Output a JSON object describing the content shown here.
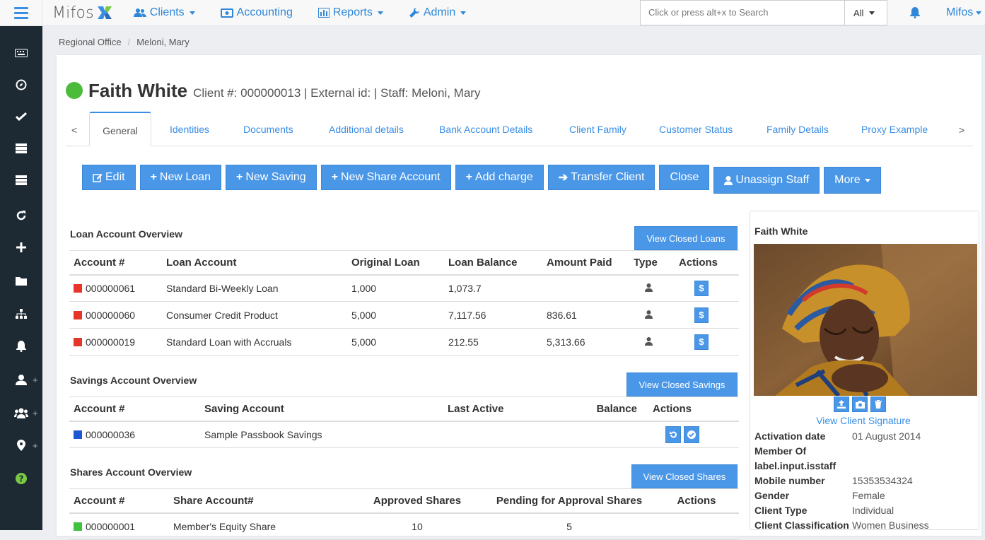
{
  "nav": {
    "brand": "Mifos",
    "clients": "Clients",
    "accounting": "Accounting",
    "reports": "Reports",
    "admin": "Admin",
    "search_placeholder": "Click or press alt+x to Search",
    "search_scope": "All",
    "user": "Mifos"
  },
  "breadcrumb": {
    "office": "Regional Office",
    "staff": "Meloni, Mary"
  },
  "client": {
    "name": "Faith White",
    "meta": "Client #: 000000013 | External id: | Staff: Meloni, Mary",
    "status_color": "#4cbb3c"
  },
  "tabs": {
    "prev": "<",
    "next": ">",
    "items": [
      "General",
      "Identities",
      "Documents",
      "Additional details",
      "Bank Account Details",
      "Client Family",
      "Customer Status",
      "Family Details",
      "Proxy Example"
    ]
  },
  "actions": {
    "edit": "Edit",
    "new_loan": "New Loan",
    "new_saving": "New Saving",
    "new_share": "New Share Account",
    "add_charge": "Add charge",
    "transfer": "Transfer Client",
    "close": "Close",
    "unassign": "Unassign Staff",
    "more": "More"
  },
  "loans": {
    "title": "Loan Account Overview",
    "view_closed": "View Closed Loans",
    "headers": [
      "Account #",
      "Loan Account",
      "Original Loan",
      "Loan Balance",
      "Amount Paid",
      "Type",
      "Actions"
    ],
    "rows": [
      {
        "account": "000000061",
        "product": "Standard Bi-Weekly Loan",
        "original": "1,000",
        "balance": "1,073.7",
        "paid": ""
      },
      {
        "account": "000000060",
        "product": "Consumer Credit Product",
        "original": "5,000",
        "balance": "7,117.56",
        "paid": "836.61"
      },
      {
        "account": "000000019",
        "product": "Standard Loan with Accruals",
        "original": "5,000",
        "balance": "212.55",
        "paid": "5,313.66"
      }
    ],
    "action_symbol": "$",
    "status_color": "#e8352a"
  },
  "savings": {
    "title": "Savings Account Overview",
    "view_closed": "View Closed Savings",
    "headers": [
      "Account #",
      "Saving Account",
      "Last Active",
      "Balance",
      "Actions"
    ],
    "rows": [
      {
        "account": "000000036",
        "product": "Sample Passbook Savings",
        "last_active": "",
        "balance": ""
      }
    ],
    "status_color": "#1a56d6"
  },
  "shares": {
    "title": "Shares Account Overview",
    "view_closed": "View Closed Shares",
    "headers": [
      "Account #",
      "Share Account#",
      "Approved Shares",
      "Pending for Approval Shares",
      "Actions"
    ],
    "rows": [
      {
        "account": "000000001",
        "product": "Member's Equity Share",
        "approved": "10",
        "pending": "5"
      }
    ],
    "status_color": "#3fc33f"
  },
  "panel": {
    "name": "Faith White",
    "signature_link": "View Client Signature",
    "info": [
      {
        "label": "Activation date",
        "value": "01 August 2014"
      },
      {
        "label": "Member Of",
        "value": ""
      },
      {
        "label": "label.input.isstaff",
        "value": ""
      },
      {
        "label": "Mobile number",
        "value": "15353534324"
      },
      {
        "label": "Gender",
        "value": "Female"
      },
      {
        "label": "Client Type",
        "value": "Individual"
      },
      {
        "label": "Client Classification",
        "value": "Women Business"
      }
    ]
  }
}
